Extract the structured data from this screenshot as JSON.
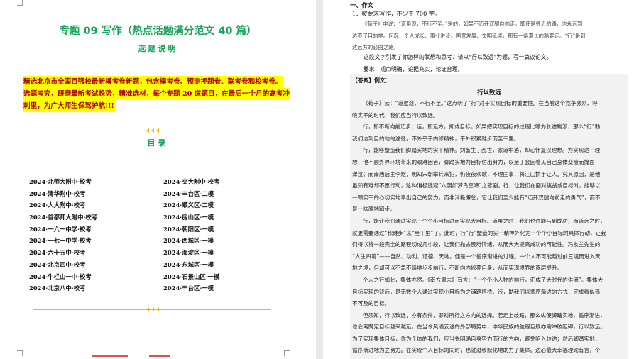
{
  "left_page": {
    "title": "专题 09  写作（热点话题满分范文 40 篇）",
    "subtitle": "选题说明",
    "highlight_lines": [
      "精选北京市全国百强校最新模考卷新题，包含模考卷、预测押题卷、联考卷和校考卷。",
      "选题考究，研磨最新考试趋势，精准选材，每个专题 20 道题目，在最后一个月的高考冲",
      "刺里，为广大师生保驾护航!!!"
    ],
    "toc_title": "目录",
    "toc_left": [
      "2024·北师大附中·校考",
      "2024·清华附中·校考",
      "2024·人大附中·校考",
      "2024·首都师大附中·校考",
      "2024·一六一中学·校考",
      "2024·一七一中学·校考",
      "2024·六十五中·校考",
      "2024·北京四中·校考",
      "2024·牛栏山一中·校考",
      "2024·北京八中·校考"
    ],
    "toc_right": [
      "2024·交大附中·校考",
      "2024·丰台区·二模",
      "2024·顺义区·二模",
      "2024·房山区·一模",
      "2024·朝阳区·一模",
      "2024·西城区·一模",
      "2024·海淀区·一模",
      "2024·东城区·一模",
      "2024·石景山区·一模",
      "2024·丰台区·一模"
    ]
  },
  "right_page": {
    "section_heading": "一、作文",
    "question_line": "1．按要求写作，不少于 700 字。",
    "quote_lines": [
      "《荀子》中说：“道虽迩，不行不至。”是的，如果不迈开双腿向前走，即使是很近的路，也永远到",
      "达不了目的地。何况，个人成长、事业进步、国家发展、文明延续，都有一条漫长的路要走。“行”是到",
      "达远方的必由之路。"
    ],
    "prompt_line": "这段文字引发了你怎样的联想和思考？请以“行以致远”为题，写一篇议论文。",
    "requirement_line": "要求：观点明确，论据充实，论证合理。",
    "answer_label": "【答案】例文：",
    "essay_title": "行以致远",
    "essay_lines": [
      "《荀子》云：“道虽迩，不行不至。”这点明了“行”对于实现目标的重要性。在当前这个竞争激烈、呼",
      "唤实干的时代，我们应当行以致远。",
      "行，即不断向前迈步；远，即远方，抑或目标。如果把实现目标的过程比喻为长途跋涉，那么“行”助",
      "我们达到目的地的途径，不外乎于内修精神，于外积累跬步而至千里。",
      "行，能够塑造我们脚踏实地的实干精神。刘备生于乱世，家道中落，却心怀复汉理想。为实现这一理",
      "想，他不顾外界环境带来的艰难困苦，脚踏实地为目标付出努力，以至于会因看见自己身体变瘦而掩面",
      "涕泣；而南唐后主李煜，明知宋朝举兵来犯，仍夜夜欢歌，不理国事，将江山拱手让人。究其原因，是他",
      "虽知有难却不愿行动，这种消极逃避“六朝如梦鸟空啼”之悲剧。行，让我们在面对挑战或目标时，能够以",
      "一颗实干的心切实地奉出自己的努力，而非消极懈怠，它让我们至少能有“迈开双腿向前走的勇气”，而不",
      "是一味原地踏步。",
      "行，能让我们通过实现一个个小目标进而实现大目标。道虽之时，我们也许能马到成功；而道远之时，",
      "就更需要通过“积跬步”来“至千里”了。此时，行“行”塑造的实干精神外化为一个个小目标的具体行动，让我",
      "们得以将一段完全的路程切成几小段，让我们抛去畏难情绪，从而大大提高成功的可能性。冯友兰先生的",
      "“人生四境”——自然、功利、道德、天地，便是一个循序渐进的过程。一个人不可能越过前三境而进入天",
      "地之境，但却可以不急不躁地步步前行，不断向内修养自身，从而实现境界的逐层提升。",
      "个人之行如此，集体亦然。《南方周末》有言：“一个个小人物的前行，汇成了大时代的洪流”。集体大",
      "目标实现的背后，是无数个人通过实现小目标为之铺路搭桥。行，助我们以循序渐进的方式，完成看似遥",
      "不可及的目标。",
      "但须知，行以致远，亦有条件，即对所行之方向的选择。若走上歧路，那么纵使脚踏实地，循序渐进，",
      "也会离既定目标越来越远。在当今风谲云诡的外部局势中，中华民族的航程巨舰亦需冲破阻碍，行以致远。",
      "为了实现集体目标，作为个体的我们，应当先明确自身努力而行的方向，避免陷入歧途；然后脚踏实地，",
      "循序渐进地为之努力。在实现个人目标的同时，也就潜移默化地助力了集体。边心最大幸福理论有言，个"
    ],
    "essay_indent_flags": [
      1,
      0,
      1,
      0,
      1,
      0,
      0,
      0,
      0,
      0,
      1,
      0,
      0,
      0,
      0,
      1,
      0,
      0,
      1,
      0,
      0,
      0
    ]
  },
  "colors": {
    "title_green": "#1aa35a",
    "highlight_yellow": "#ffff00",
    "highlight_text_red": "#b00000",
    "divider_blue": "#8ec1e8",
    "answer_bg": "#f2f2f2"
  }
}
